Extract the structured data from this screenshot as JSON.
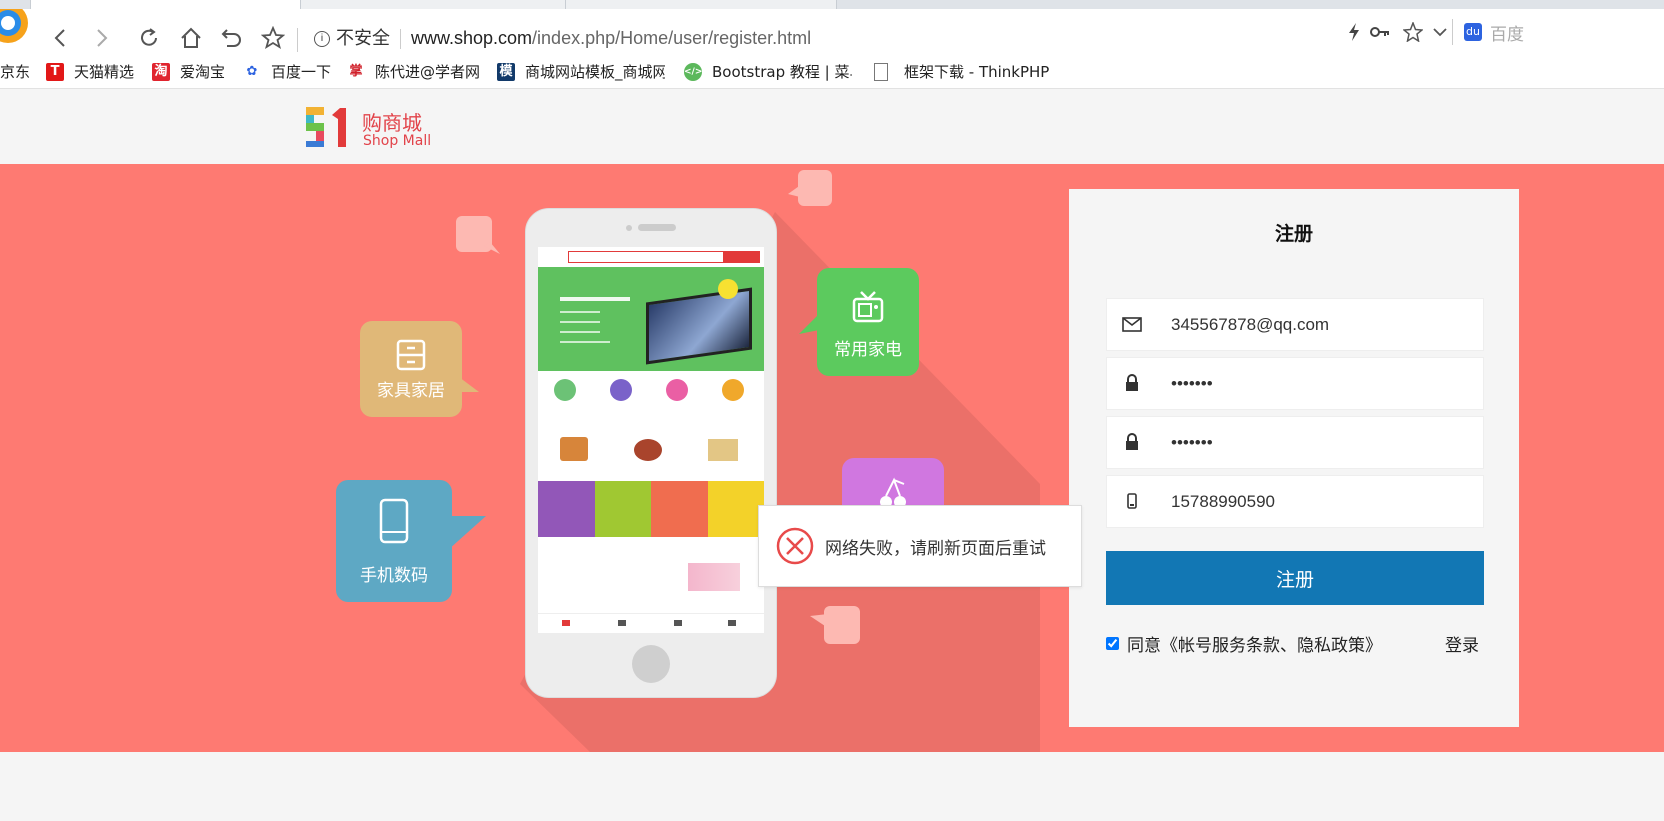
{
  "browser": {
    "address": {
      "security_label": "不安全",
      "host": "www.shop.com",
      "path": "/index.php/Home/user/register.html"
    },
    "search_engine_label": "百度",
    "bookmarks": [
      {
        "label": "京东",
        "icon": "jd-icon"
      },
      {
        "label": "天猫精选",
        "icon": "tmall-icon"
      },
      {
        "label": "爱淘宝",
        "icon": "taobao-icon"
      },
      {
        "label": "百度一下",
        "icon": "baidu-icon"
      },
      {
        "label": "陈代进@学者网",
        "icon": "scholar-icon"
      },
      {
        "label": "商城网站模板_商城网",
        "icon": "template-icon"
      },
      {
        "label": "Bootstrap 教程 | 菜鸟",
        "icon": "runoob-icon"
      },
      {
        "label": "框架下载 - ThinkPHP",
        "icon": "page-icon"
      }
    ]
  },
  "site": {
    "logo_cn": "购商城",
    "logo_en": "Shop Mall",
    "logo_mark": "51"
  },
  "hero": {
    "bubbles": {
      "furniture": "家具家居",
      "appliance": "常用家电",
      "digital": "手机数码"
    },
    "colors": {
      "background": "#fe7a72",
      "furniture": "#e0b878",
      "appliance": "#5cca5e",
      "digital": "#5ea8c4",
      "fruit": "#d077e0"
    }
  },
  "register": {
    "title": "注册",
    "email_value": "345567878@qq.com",
    "password_value": "•••••••",
    "confirm_value": "•••••••",
    "phone_value": "15788990590",
    "submit_label": "注册",
    "agree_text": "同意《帐号服务条款、隐私政策》",
    "agree_checked": true,
    "login_link": "登录",
    "button_color": "#1277b4"
  },
  "toast": {
    "message": "网络失败，请刷新页面后重试"
  }
}
